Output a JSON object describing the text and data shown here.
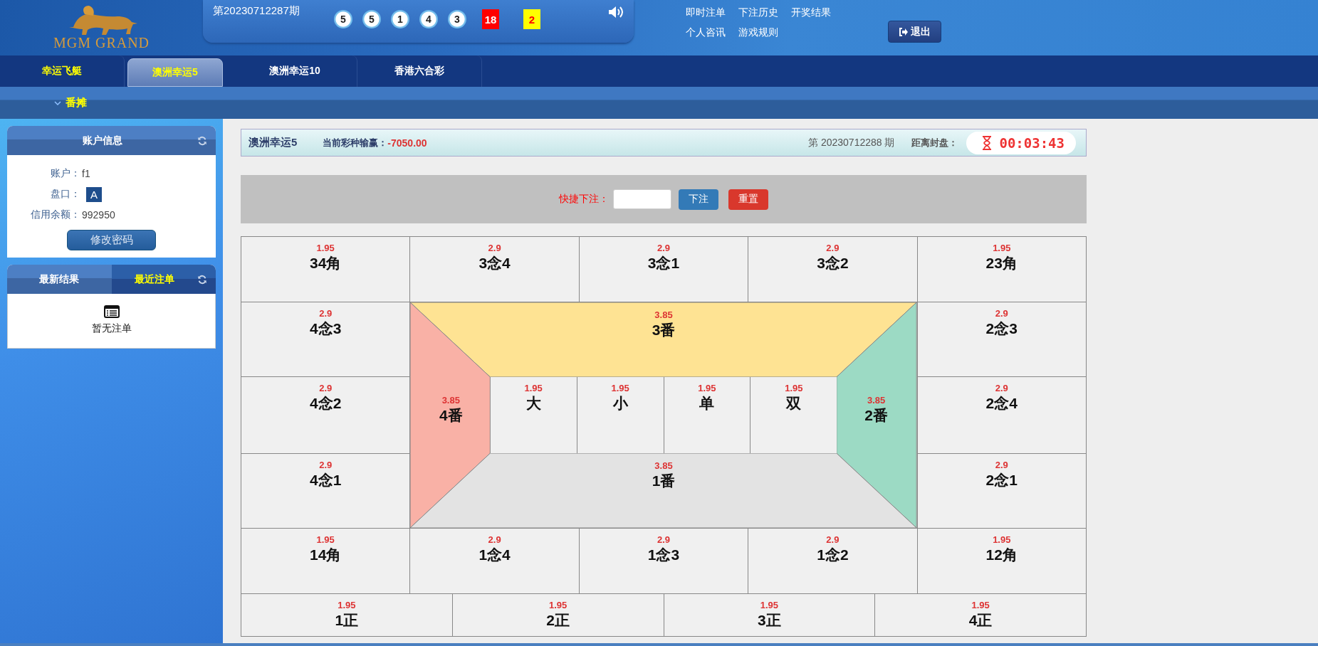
{
  "header": {
    "logo_text": "MGM GRAND",
    "period": "第20230712287期",
    "balls": [
      "5",
      "5",
      "1",
      "4",
      "3"
    ],
    "sum": "18",
    "parity": "2",
    "links": [
      [
        "即时注单",
        "下注历史",
        "开奖结果"
      ],
      [
        "个人咨讯",
        "游戏规则"
      ]
    ],
    "logout": "退出"
  },
  "tabs": [
    {
      "label": "幸运飞艇",
      "selected": false,
      "highlighted": true
    },
    {
      "label": "澳洲幸运5",
      "selected": true,
      "highlighted": true
    },
    {
      "label": "澳洲幸运10",
      "selected": false,
      "highlighted": false
    },
    {
      "label": "香港六合彩",
      "selected": false,
      "highlighted": false
    }
  ],
  "subnav": {
    "label": "番摊"
  },
  "account": {
    "title": "账户信息",
    "rows": [
      {
        "label": "账户：",
        "value": "f1",
        "kind": "text"
      },
      {
        "label": "盘口：",
        "value": "A",
        "kind": "badge"
      },
      {
        "label": "信用余额：",
        "value": "992950",
        "kind": "text"
      }
    ],
    "button": "修改密码"
  },
  "recent": {
    "tabs": [
      {
        "label": "最新结果",
        "selected": false
      },
      {
        "label": "最近注单",
        "selected": true
      }
    ],
    "empty": "暂无注单"
  },
  "info_bar": {
    "game": "澳洲幸运5",
    "profit_label": "当前彩种输赢：",
    "profit": "-7050.00",
    "period": "第 20230712288 期",
    "close_label": "距离封盘：",
    "countdown": "00:03:43"
  },
  "quick_bet": {
    "label": "快捷下注：",
    "submit": "下注",
    "reset": "重置"
  },
  "grid": {
    "row_1": [
      {
        "odds": "1.95",
        "label": "34角"
      },
      {
        "odds": "2.9",
        "label": "3念4"
      },
      {
        "odds": "2.9",
        "label": "3念1"
      },
      {
        "odds": "2.9",
        "label": "3念2"
      },
      {
        "odds": "1.95",
        "label": "23角"
      }
    ],
    "left_column": [
      {
        "odds": "2.9",
        "label": "4念3"
      },
      {
        "odds": "2.9",
        "label": "4念2"
      },
      {
        "odds": "2.9",
        "label": "4念1"
      }
    ],
    "right_column": [
      {
        "odds": "2.9",
        "label": "2念3"
      },
      {
        "odds": "2.9",
        "label": "2念4"
      },
      {
        "odds": "2.9",
        "label": "2念1"
      }
    ],
    "center": {
      "top": {
        "odds": "3.85",
        "label": "3番"
      },
      "left": {
        "odds": "3.85",
        "label": "4番"
      },
      "right": {
        "odds": "3.85",
        "label": "2番"
      },
      "bottom": {
        "odds": "3.85",
        "label": "1番"
      },
      "inner": [
        {
          "odds": "1.95",
          "label": "大"
        },
        {
          "odds": "1.95",
          "label": "小"
        },
        {
          "odds": "1.95",
          "label": "单"
        },
        {
          "odds": "1.95",
          "label": "双"
        }
      ]
    },
    "row_5": [
      {
        "odds": "1.95",
        "label": "14角"
      },
      {
        "odds": "2.9",
        "label": "1念4"
      },
      {
        "odds": "2.9",
        "label": "1念3"
      },
      {
        "odds": "2.9",
        "label": "1念2"
      },
      {
        "odds": "1.95",
        "label": "12角"
      }
    ],
    "row_6": [
      {
        "odds": "1.95",
        "label": "1正"
      },
      {
        "odds": "1.95",
        "label": "2正"
      },
      {
        "odds": "1.95",
        "label": "3正"
      },
      {
        "odds": "1.95",
        "label": "4正"
      }
    ]
  }
}
